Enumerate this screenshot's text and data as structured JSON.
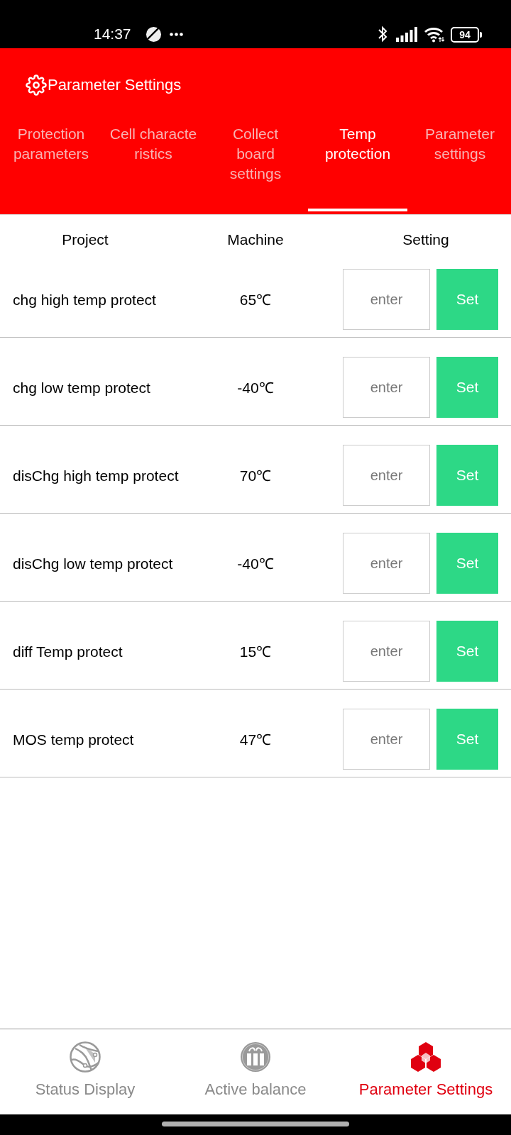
{
  "status_bar": {
    "time": "14:37",
    "battery": "94"
  },
  "header": {
    "title": "Parameter Settings"
  },
  "tabs": [
    {
      "lines": [
        "Protection",
        "parameters"
      ],
      "selected": false
    },
    {
      "lines": [
        "Cell characte",
        "ristics"
      ],
      "selected": false
    },
    {
      "lines": [
        "Collect",
        "board",
        "settings"
      ],
      "selected": false
    },
    {
      "lines": [
        "Temp",
        "protection"
      ],
      "selected": true
    },
    {
      "lines": [
        "Parameter",
        "settings"
      ],
      "selected": false
    }
  ],
  "table": {
    "columns": [
      "Project",
      "Machine",
      "Setting"
    ],
    "rows": [
      {
        "project": "chg high temp protect",
        "machine": "65℃",
        "placeholder": "enter",
        "button": "Set"
      },
      {
        "project": "chg low temp protect",
        "machine": "-40℃",
        "placeholder": "enter",
        "button": "Set"
      },
      {
        "project": "disChg high temp protect",
        "machine": "70℃",
        "placeholder": "enter",
        "button": "Set"
      },
      {
        "project": "disChg low temp protect",
        "machine": "-40℃",
        "placeholder": "enter",
        "button": "Set"
      },
      {
        "project": "diff Temp protect",
        "machine": "15℃",
        "placeholder": "enter",
        "button": "Set"
      },
      {
        "project": "MOS temp protect",
        "machine": "47℃",
        "placeholder": "enter",
        "button": "Set"
      }
    ]
  },
  "bottom_nav": [
    {
      "kind": "status",
      "label": "Status Display",
      "selected": false
    },
    {
      "kind": "balance",
      "label": "Active balance",
      "selected": false
    },
    {
      "kind": "parameters",
      "label": "Parameter Settings",
      "selected": true
    }
  ]
}
